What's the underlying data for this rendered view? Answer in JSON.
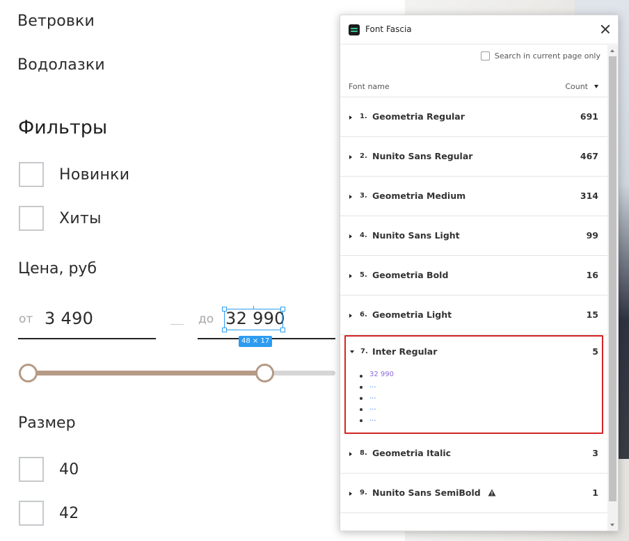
{
  "catalog": {
    "categories": [
      "Ветровки",
      "Водолазки"
    ]
  },
  "filters": {
    "title": "Фильтры",
    "flags": [
      {
        "label": "Новинки",
        "checked": false
      },
      {
        "label": "Хиты",
        "checked": false
      }
    ],
    "price": {
      "title": "Цена, руб",
      "from_prefix": "от",
      "from_value": "3 490",
      "to_prefix": "до",
      "to_value": "32 990",
      "slider_from_fraction": 0.0,
      "slider_to_fraction": 0.77
    },
    "size": {
      "title": "Размер",
      "options": [
        {
          "label": "40",
          "checked": false
        },
        {
          "label": "42",
          "checked": false
        }
      ]
    }
  },
  "inspector": {
    "selection_size": "48 × 17",
    "accent_color": "#2d9cf0"
  },
  "popup": {
    "title": "Font Fascia",
    "search_label": "Search in current page only",
    "search_checked": false,
    "col_font_name": "Font name",
    "col_count": "Count",
    "highlight_color": "#d42424",
    "fonts": [
      {
        "num": "1.",
        "name": "Geometria Regular",
        "count": "691"
      },
      {
        "num": "2.",
        "name": "Nunito Sans Regular",
        "count": "467"
      },
      {
        "num": "3.",
        "name": "Geometria Medium",
        "count": "314"
      },
      {
        "num": "4.",
        "name": "Nunito Sans Light",
        "count": "99"
      },
      {
        "num": "5.",
        "name": "Geometria Bold",
        "count": "16"
      },
      {
        "num": "6.",
        "name": "Geometria Light",
        "count": "15"
      },
      {
        "num": "7.",
        "name": "Inter Regular",
        "count": "5",
        "expanded": true,
        "occurrences": [
          "32 990",
          "...",
          "...",
          "...",
          "..."
        ]
      },
      {
        "num": "8.",
        "name": "Geometria Italic",
        "count": "3"
      },
      {
        "num": "9.",
        "name": "Nunito Sans SemiBold",
        "count": "1",
        "warning": true
      }
    ]
  }
}
